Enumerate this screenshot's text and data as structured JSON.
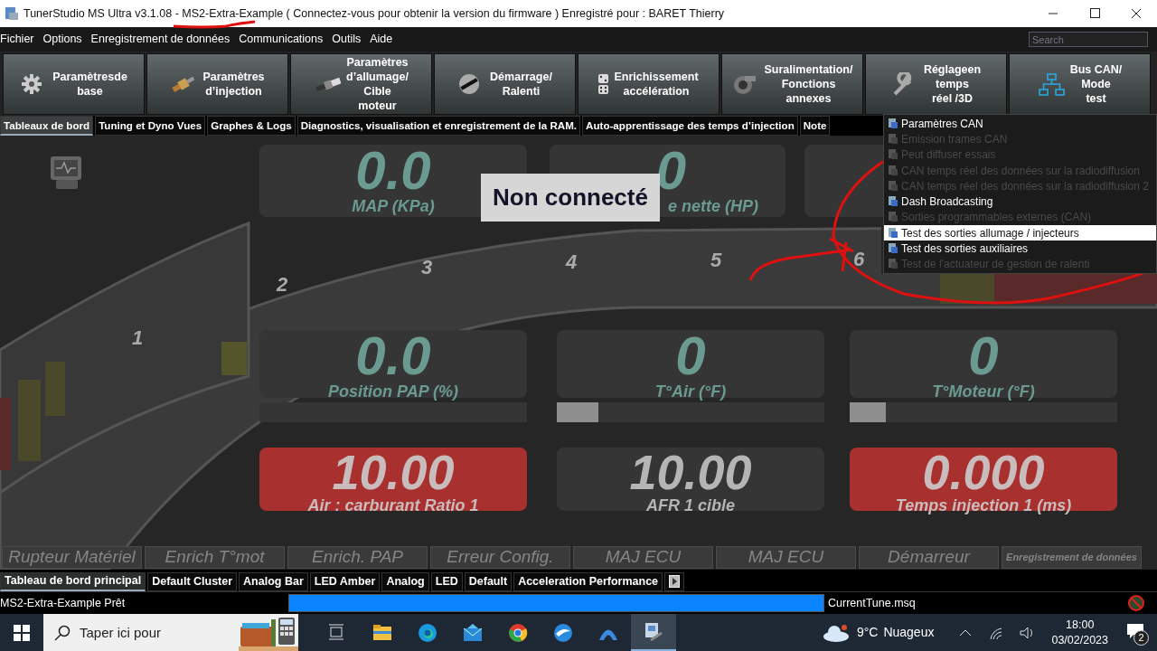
{
  "window": {
    "title": "TunerStudio MS Ultra v3.1.08 - MS2-Extra-Example ( Connectez-vous pour obtenir la version du firmware ) Enregistré pour : BARET Thierry"
  },
  "menu": [
    "Fichier",
    "Options",
    "Enregistrement de données",
    "Communications",
    "Outils",
    "Aide"
  ],
  "search": {
    "placeholder": "Search"
  },
  "toolbar": [
    {
      "label": "Paramètresde\nbase",
      "kind": "gear"
    },
    {
      "label": "Paramètres\nd’injection",
      "kind": "injector"
    },
    {
      "label": "Paramètres\nd’allumage/\nCible\nmoteur",
      "kind": "plug"
    },
    {
      "label": "Démarrage/\nRalenti",
      "kind": "dial"
    },
    {
      "label": "Enrichissement\naccélération",
      "kind": "dice"
    },
    {
      "label": "Suralimentation/\nFonctions\nannexes",
      "kind": "turbo"
    },
    {
      "label": "Réglageen\ntemps\nréel /3D",
      "kind": "wrench"
    },
    {
      "label": "Bus CAN/\nMode\ntest",
      "kind": "network"
    }
  ],
  "tabs": [
    {
      "label": "Tableaux de bord",
      "selected": true
    },
    {
      "label": "Tuning et Dyno Vues",
      "selected": false
    },
    {
      "label": "Graphes & Logs",
      "selected": false
    },
    {
      "label": "Diagnostics, visualisation et enregistrement de la RAM.",
      "selected": false
    },
    {
      "label": "Auto-apprentissage des temps d’injection",
      "selected": false
    },
    {
      "label": "Note",
      "selected": false
    }
  ],
  "tachometer": {
    "ticks": [
      "1",
      "2",
      "3",
      "4",
      "5",
      "6"
    ]
  },
  "gauges": [
    {
      "kind": "digital",
      "value": "0.0",
      "label": "MAP (KPa)",
      "alarm": false
    },
    {
      "kind": "digital",
      "value": "0",
      "label": "e nette (HP)",
      "alarm": false
    },
    {
      "kind": "blank"
    },
    {
      "kind": "digital",
      "value": "0.0",
      "label": "Position PAP (%)",
      "alarm": false
    },
    {
      "kind": "digital",
      "value": "0",
      "label": "T°Air (°F)",
      "alarm": false
    },
    {
      "kind": "digital",
      "value": "0",
      "label": "T°Moteur (°F)",
      "alarm": false
    },
    {
      "kind": "bar",
      "level": 0
    },
    {
      "kind": "bar",
      "level": 0.155
    },
    {
      "kind": "bar",
      "level": 0.135
    },
    {
      "kind": "digital",
      "value": "10.00",
      "label": "Air : carburant Ratio 1",
      "alarm": true
    },
    {
      "kind": "digital",
      "value": "10.00",
      "label": "AFR 1 cible",
      "alarm": false
    },
    {
      "kind": "digital",
      "value": "0.000",
      "label": "Temps injection 1 (ms)",
      "alarm": true
    }
  ],
  "overlay": {
    "text": "Non connecté"
  },
  "indicators": [
    "Rupteur Matériel",
    "Enrich T°mot",
    "Enrich. PAP",
    "Erreur Config.",
    "MAJ ECU",
    "MAJ ECU",
    "Démarreur",
    "Enregistrement de données"
  ],
  "dashboard_tabs": [
    {
      "label": "Tableau de bord principal",
      "selected": true
    },
    {
      "label": "Default Cluster",
      "selected": false
    },
    {
      "label": "Analog Bar",
      "selected": false
    },
    {
      "label": "LED Amber",
      "selected": false
    },
    {
      "label": "Analog",
      "selected": false
    },
    {
      "label": "LED",
      "selected": false
    },
    {
      "label": "Default",
      "selected": false
    },
    {
      "label": "Acceleration Performance",
      "selected": false
    }
  ],
  "popup_menu": [
    {
      "label": "Paramètres CAN",
      "disabled": false,
      "selected": false
    },
    {
      "label": "Emission trames CAN",
      "disabled": true,
      "selected": false
    },
    {
      "label": "Peut diffuser essais",
      "disabled": true,
      "selected": false
    },
    {
      "label": "CAN temps réel des données sur la radiodiffusion",
      "disabled": true,
      "selected": false
    },
    {
      "label": "CAN temps réel des données sur la radiodiffusion 2",
      "disabled": true,
      "selected": false
    },
    {
      "label": "Dash Broadcasting",
      "disabled": false,
      "selected": false
    },
    {
      "label": "Sorties programmables externes (CAN)",
      "disabled": true,
      "selected": false
    },
    {
      "label": "Test des sorties allumage / injecteurs",
      "disabled": false,
      "selected": true
    },
    {
      "label": "Test des sorties auxiliaires",
      "disabled": false,
      "selected": false
    },
    {
      "label": "Test de l'actuateur de gestion de ralenti",
      "disabled": true,
      "selected": false
    }
  ],
  "status_bar": {
    "message": "MS2-Extra-Example Prêt",
    "level": 1,
    "file": "CurrentTune.msq"
  },
  "taskbar": {
    "search_placeholder": "Taper ici pour",
    "temperature": "9°C",
    "weather": "Nuageux",
    "time": "18:00",
    "date": "03/02/2023",
    "notifications": "2"
  }
}
